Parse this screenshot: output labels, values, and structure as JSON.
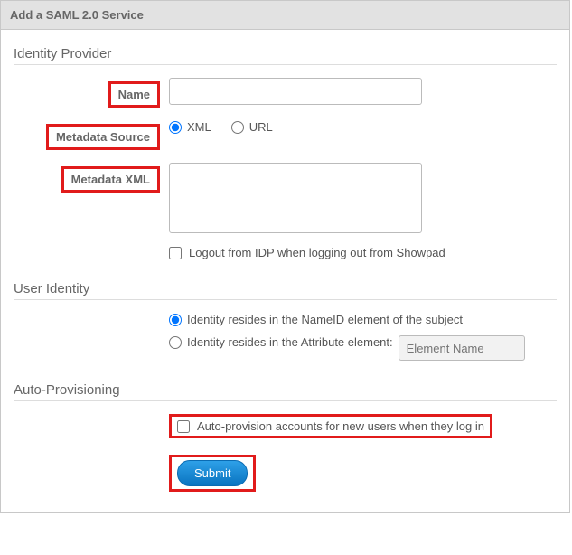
{
  "window": {
    "title": "Add a SAML 2.0 Service"
  },
  "sections": {
    "idp": {
      "title": "Identity Provider",
      "name_label": "Name",
      "name_value": "",
      "metadata_source_label": "Metadata Source",
      "source_options": {
        "xml": "XML",
        "url": "URL"
      },
      "metadata_xml_label": "Metadata XML",
      "metadata_xml_value": "",
      "logout_label": "Logout from IDP when logging out from Showpad"
    },
    "user_identity": {
      "title": "User Identity",
      "opt_nameid": "Identity resides in the NameID element of the subject",
      "opt_attribute": "Identity resides in the Attribute element:",
      "attribute_placeholder": "Element Name",
      "attribute_value": ""
    },
    "auto_prov": {
      "title": "Auto-Provisioning",
      "checkbox_label": "Auto-provision accounts for new users when they log in"
    }
  },
  "actions": {
    "submit": "Submit"
  }
}
